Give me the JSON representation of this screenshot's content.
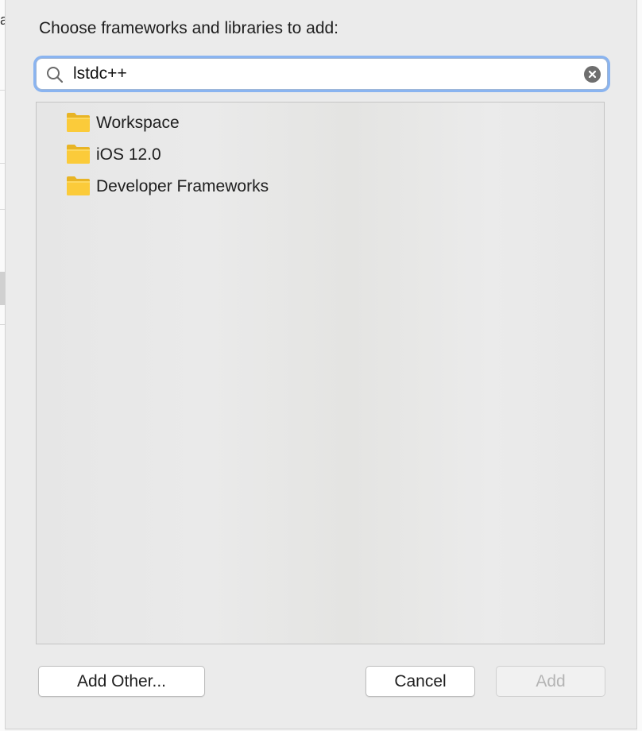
{
  "dialog": {
    "title": "Choose frameworks and libraries to add:"
  },
  "search": {
    "value": "lstdc++",
    "placeholder": ""
  },
  "list": {
    "items": [
      {
        "label": "Workspace",
        "icon": "folder-icon"
      },
      {
        "label": "iOS 12.0",
        "icon": "folder-icon"
      },
      {
        "label": "Developer Frameworks",
        "icon": "folder-icon"
      }
    ]
  },
  "buttons": {
    "add_other": "Add Other...",
    "cancel": "Cancel",
    "add": "Add"
  },
  "colors": {
    "focus_ring": "#8ab4f0",
    "folder": "#f9c934",
    "disabled_text": "#b4b4b4"
  }
}
